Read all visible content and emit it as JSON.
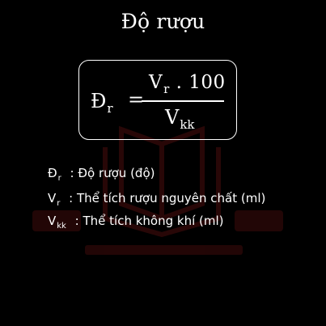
{
  "title": "Độ rượu",
  "formula": {
    "lhs_symbol": "Đ",
    "lhs_sub": "r",
    "equals": "=",
    "num_symbol": "V",
    "num_sub": "r",
    "num_rest": ". 100",
    "den_symbol": "V",
    "den_sub": "kk"
  },
  "legend": [
    {
      "symbol": "Đ",
      "sub": "r",
      "colon": ":",
      "text": "Độ rượu (độ)"
    },
    {
      "symbol": "V",
      "sub": "r",
      "colon": ":",
      "text": "Thể tích rượu nguyên chất (ml)"
    },
    {
      "symbol": "V",
      "sub": "kk",
      "colon": ":",
      "text": "Thể tích không khí (ml)"
    }
  ],
  "colors": {
    "background": "#000000",
    "text": "#ffffff",
    "watermark": "#4a0d0d"
  },
  "watermark_icon": "open-book-icon"
}
